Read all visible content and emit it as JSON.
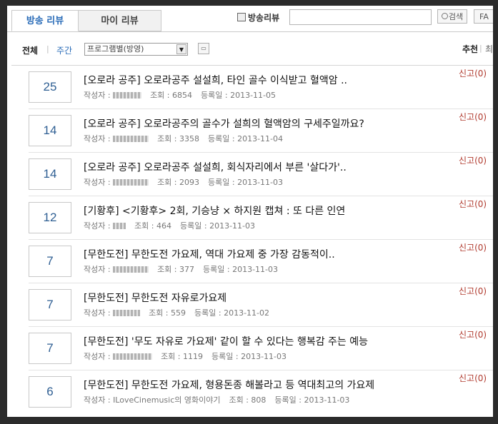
{
  "tabs": [
    {
      "label": "방송 리뷰",
      "active": true
    },
    {
      "label": "마이 리뷰",
      "active": false
    }
  ],
  "search": {
    "label": "방송리뷰",
    "placeholder": "",
    "button_label": "검색",
    "extra_button_label": "FA"
  },
  "filter": {
    "all_label": "전체",
    "separator": "|",
    "week_label": "주간",
    "select_value": "프로그램별(방영)",
    "recommend_label": "추천",
    "separator2": "|",
    "truncated_label": "최"
  },
  "rows": [
    {
      "count": "25",
      "title": "[오로라 공주] 오로라공주 설설희, 타인 골수 이식받고 혈액암 ..",
      "author_label": "작성자 :",
      "views_label": "조회 :",
      "views": "6854",
      "date_label": "등록일 :",
      "date": "2013-11-05",
      "report": "신고(0)"
    },
    {
      "count": "14",
      "title": "[오로라 공주] 오로라공주의 골수가 설희의 혈액암의 구세주일까요?",
      "author_label": "작성자 :",
      "views_label": "조회 :",
      "views": "3358",
      "date_label": "등록일 :",
      "date": "2013-11-04",
      "report": "신고(0)"
    },
    {
      "count": "14",
      "title": "[오로라 공주] 오로라공주 설설희, 회식자리에서 부른 '살다가'..",
      "author_label": "작성자 :",
      "views_label": "조회 :",
      "views": "2093",
      "date_label": "등록일 :",
      "date": "2013-11-03",
      "report": "신고(0)"
    },
    {
      "count": "12",
      "title": "[기황후] <기황후> 2회, 기승냥 × 하지원 캡쳐 : 또 다른 인연",
      "author_label": "작성자 :",
      "views_label": "조회 :",
      "views": "464",
      "date_label": "등록일 :",
      "date": "2013-11-03",
      "report": "신고(0)"
    },
    {
      "count": "7",
      "title": "[무한도전] 무한도전 가요제, 역대 가요제 중 가장 감동적이..",
      "author_label": "작성자 :",
      "views_label": "조회 :",
      "views": "377",
      "date_label": "등록일 :",
      "date": "2013-11-03",
      "report": "신고(0)"
    },
    {
      "count": "7",
      "title": "[무한도전] 무한도전 자유로가요제",
      "author_label": "작성자 :",
      "views_label": "조회 :",
      "views": "559",
      "date_label": "등록일 :",
      "date": "2013-11-02",
      "report": "신고(0)"
    },
    {
      "count": "7",
      "title": "[무한도전] '무도 자유로 가요제' 같이 할 수 있다는 행복감 주는 예능",
      "author_label": "작성자 :",
      "views_label": "조회 :",
      "views": "1119",
      "date_label": "등록일 :",
      "date": "2013-11-03",
      "report": "신고(0)"
    },
    {
      "count": "6",
      "title": "[무한도전] 무한도전 가요제, 형용돈종 해볼라고 등 역대최고의 가요제",
      "author_label": "작성자 :",
      "author": "ILoveCinemusic의 영화이야기",
      "views_label": "조회 :",
      "views": "808",
      "date_label": "등록일 :",
      "date": "2013-11-03",
      "report": "신고(0)"
    }
  ]
}
